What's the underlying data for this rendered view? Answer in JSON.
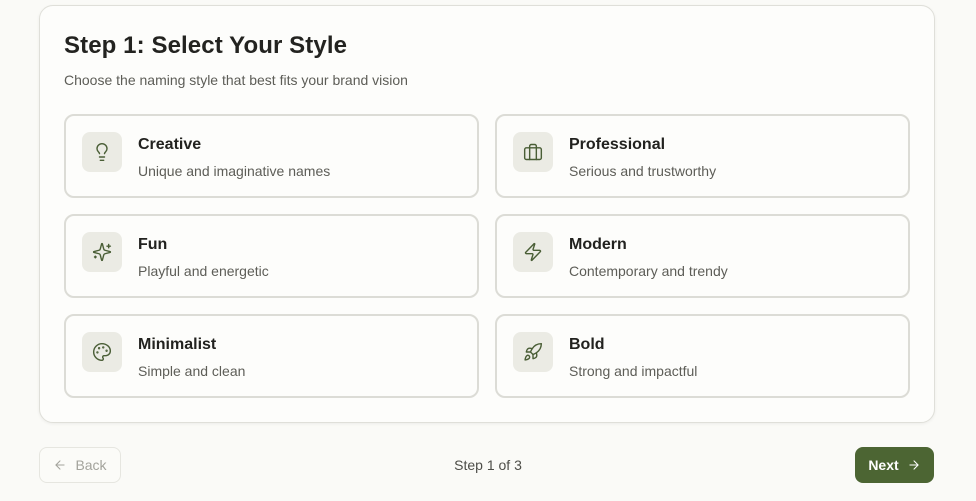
{
  "header": {
    "title": "Step 1: Select Your Style",
    "subtitle": "Choose the naming style that best fits your brand vision"
  },
  "options": [
    {
      "label": "Creative",
      "description": "Unique and imaginative names",
      "icon": "lightbulb-icon"
    },
    {
      "label": "Professional",
      "description": "Serious and trustworthy",
      "icon": "briefcase-icon"
    },
    {
      "label": "Fun",
      "description": "Playful and energetic",
      "icon": "sparkles-icon"
    },
    {
      "label": "Modern",
      "description": "Contemporary and trendy",
      "icon": "zap-icon"
    },
    {
      "label": "Minimalist",
      "description": "Simple and clean",
      "icon": "palette-icon"
    },
    {
      "label": "Bold",
      "description": "Strong and impactful",
      "icon": "rocket-icon"
    }
  ],
  "footer": {
    "back_label": "Back",
    "step_indicator": "Step 1 of 3",
    "next_label": "Next"
  },
  "colors": {
    "accent": "#4c6533",
    "icon_bg": "#ebebe4",
    "border": "#dcdcd6"
  }
}
